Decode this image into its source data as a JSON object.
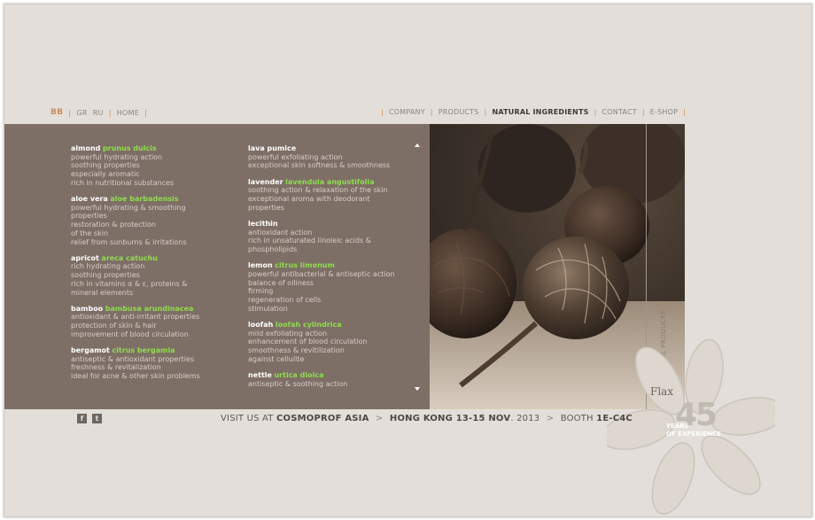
{
  "top_nav_left": {
    "logo": "BB",
    "items": [
      "GR",
      "RU",
      "HOME"
    ]
  },
  "top_nav_right": {
    "items": [
      "COMPANY",
      "PRODUCTS",
      "NATURAL INGREDIENTS",
      "CONTACT",
      "E-SHOP"
    ],
    "active": "NATURAL INGREDIENTS"
  },
  "ingredients_col1": [
    {
      "name": "almond",
      "latin": "prunus dulcis",
      "desc": [
        "powerful hydrating action",
        "soothing properties",
        "especially aromatic",
        "rich in nutritional substances"
      ]
    },
    {
      "name": "aloe vera",
      "latin": "aloe barbadensis",
      "desc": [
        "powerful hydrating & smoothing",
        "properties",
        "restoration & protection",
        "of the skin",
        "relief from sunburns & irritations"
      ]
    },
    {
      "name": "apricot",
      "latin": "areca catuchu",
      "desc": [
        "rich hydrating action",
        "soothing properties",
        "rich in vitamins α & ε, proteins &",
        "mineral elements"
      ]
    },
    {
      "name": "bamboo",
      "latin": "bambusa arundinacea",
      "desc": [
        "antioxidant & anti-irritant properties",
        "protection of skin & hair",
        "improvement of blood circulation"
      ]
    },
    {
      "name": "bergamot",
      "latin": "citrus bergamia",
      "desc": [
        "antiseptic & antioxidant properties",
        "freshness & revitalization",
        "ideal for acne & other skin problems"
      ]
    }
  ],
  "ingredients_col2": [
    {
      "name": "lava pumice",
      "latin": "",
      "desc": [
        "powerful exfoliating action",
        "exceptional skin softness & smoothness"
      ]
    },
    {
      "name": "lavender",
      "latin": "lavendula angustifolia",
      "desc": [
        "soothing action & relaxation of the skin",
        "exceptional aroma with deodorant",
        "properties"
      ]
    },
    {
      "name": "lecithin",
      "latin": "",
      "desc": [
        "antioxidant action",
        "rich in unsaturated linoleic acids &",
        "phospholipids"
      ]
    },
    {
      "name": "lemon",
      "latin": "citrus limonum",
      "desc": [
        "powerful antibacterial & antiseptic action",
        "balance of oiliness",
        "firming",
        "regeneration of cells",
        "stimulation"
      ]
    },
    {
      "name": "loofah",
      "latin": "loofah cylindrica",
      "desc": [
        "mild exfoliating action",
        "enhancement of blood circulation",
        "smoothness & revitilization",
        "against cellulite"
      ]
    },
    {
      "name": "nettle",
      "latin": "urtica dioica",
      "desc": [
        "antiseptic & soothing action"
      ]
    }
  ],
  "side_label": "NATURAL PRODUCTS",
  "brand": "Flax",
  "badge": {
    "number": "45",
    "line1": "YEARS",
    "line2": "OF EXPERIENCE"
  },
  "social": [
    {
      "icon": "facebook-icon",
      "glyph": "f"
    },
    {
      "icon": "twitter-icon",
      "glyph": "t"
    }
  ],
  "visit": {
    "prefix": "VISIT US AT",
    "event": "COSMOPROF ASIA",
    "gt": ">",
    "place": "HONG KONG 13-15 NOV",
    "year": ". 2013",
    "booth_label": "BOOTH",
    "booth": "1E-C4C"
  },
  "colors": {
    "panel": "#7e6f66",
    "accent_green": "#8fdc4e",
    "accent_orange": "#c98f5f",
    "background": "#e3ded9"
  }
}
